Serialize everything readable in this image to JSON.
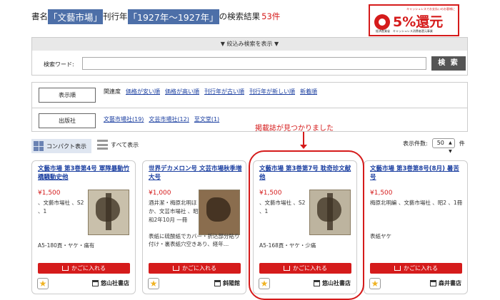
{
  "header": {
    "prefix": "書名",
    "keyword": "「文藝市場」",
    "mid": "刊行年",
    "year": "「1927年〜1927年」",
    "suffix": "の検索結果",
    "count": "53件"
  },
  "cashless_banner": {
    "top_note": "キャッシュレスでお支払いのお客様に",
    "percent": "5%還元",
    "footer": "経済産業省　キャッシュレス消費者還元事業"
  },
  "search": {
    "toggle_label": "▼ 絞込み検索を表示 ▼",
    "label": "検索ワード:",
    "value": "",
    "button": "検 索"
  },
  "sort": {
    "label": "表示順",
    "items": [
      "関連度",
      "価格が安い順",
      "価格が高い順",
      "刊行年が古い順",
      "刊行年が新しい順",
      "新着順"
    ]
  },
  "publisher": {
    "label": "出版社",
    "items": [
      "文藝市場社(19)",
      "文芸市場社(12)",
      "至文堂(1)"
    ]
  },
  "annotation": "掲載誌が見つかりました",
  "view": {
    "compact": "コンパクト表示",
    "all": "すべて表示",
    "per_page_label": "表示件数:",
    "per_page_value": "50",
    "per_page_unit": "件"
  },
  "cards": [
    {
      "title": "文藝市場 第3巻第4号 軍隊暴動竹橋騒動史他",
      "price": "¥1,500",
      "info": "、文藝市場社 、S2 、1",
      "condition": "A5-180頁・ヤケ・痛有",
      "cart": "かごに入れる",
      "shop": "悠山社書店"
    },
    {
      "title": "世界デカメロン号 文芸市場秋季増大号",
      "price": "¥1,000",
      "info": "酒井潔・梅原北明ほか、文芸市場社 、昭和2年10月 一冊",
      "condition": "表紙に硫酸紙でカバー・折込部分貼り付け・裏表紙穴空きあり、経年…",
      "cart": "かごに入れる",
      "shop": "斜陽館"
    },
    {
      "title": "文藝市場 第3巻第7号 耽奇珍文献他",
      "price": "¥1,500",
      "info": "、文藝市場社 、S2 、1",
      "condition": "A5-168頁・ヤケ・少痛",
      "cart": "かごに入れる",
      "shop": "悠山社書店"
    },
    {
      "title": "文藝市場 第3巻第8号(8月) 暑苦号",
      "price": "¥1,500",
      "info": "梅原北明編 、文藝市場社 、昭2 、1冊",
      "condition": "表紙ヤケ",
      "cart": "かごに入れる",
      "shop": "森井書店"
    }
  ]
}
